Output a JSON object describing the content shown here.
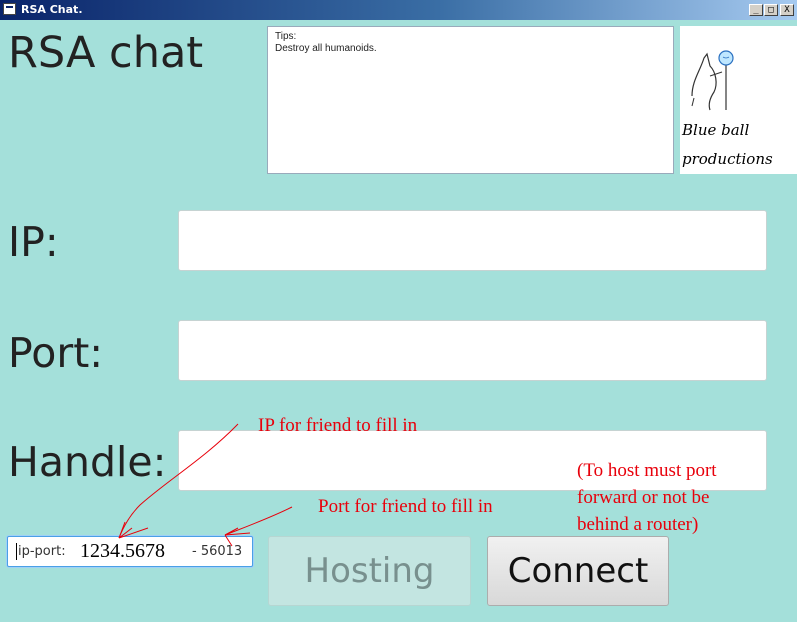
{
  "window": {
    "title": "RSA Chat.",
    "controls": {
      "minimize": "_",
      "maximize": "□",
      "close": "X"
    }
  },
  "app_title": "RSA chat",
  "tips": {
    "heading": "Tips:",
    "text": "Destroy all humanoids."
  },
  "logo": {
    "line1": "Blue ball",
    "line2": "productions"
  },
  "form": {
    "ip_label": "IP:",
    "ip_value": "",
    "port_label": "Port:",
    "port_value": "",
    "handle_label": "Handle:",
    "handle_value": ""
  },
  "ip_port_display": {
    "label": "ip-port:",
    "ip": "1234.5678",
    "port": "- 56013"
  },
  "buttons": {
    "hosting": "Hosting",
    "connect": "Connect"
  },
  "annotations": {
    "ip_note": "IP for friend to fill in",
    "port_note": "Port for friend to fill in",
    "host_note_line1": "(To host must port",
    "host_note_line2": "forward or not be",
    "host_note_line3": "behind a router)"
  },
  "colors": {
    "background": "#a4e0da",
    "annotation": "#e8000b",
    "focus_border": "#4aa0e6"
  }
}
